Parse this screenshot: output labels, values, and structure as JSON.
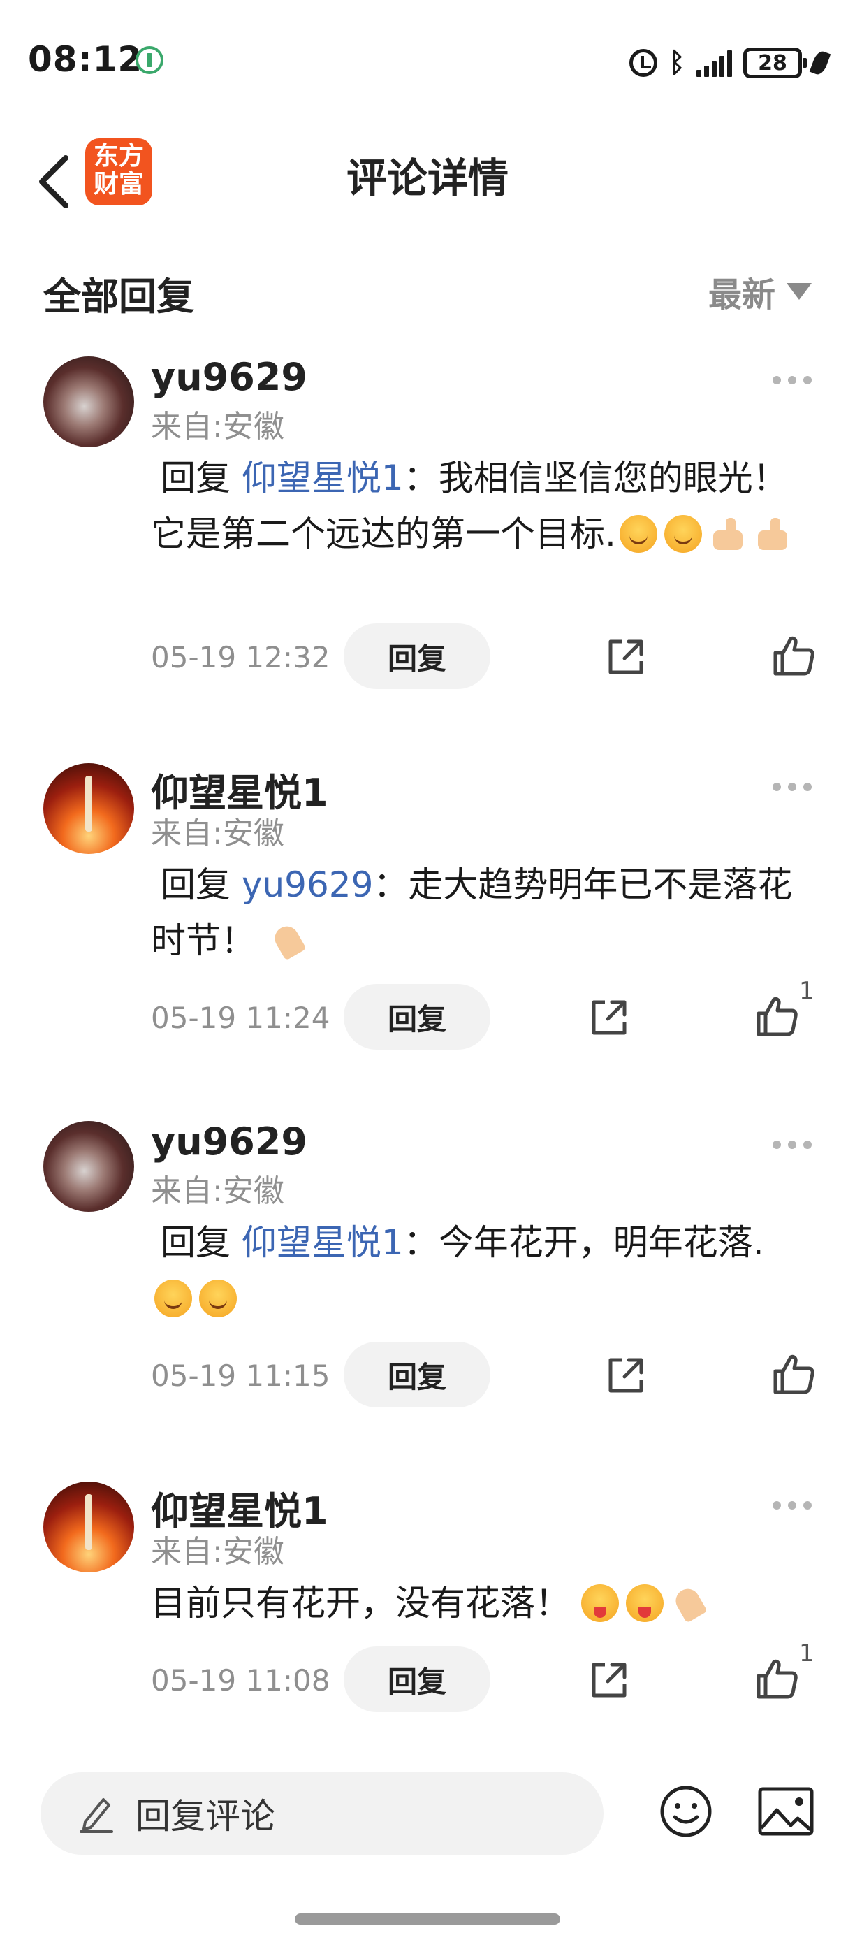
{
  "status_bar": {
    "time": "08:12",
    "battery": "28"
  },
  "header": {
    "title": "评论详情",
    "logo_line1": "东方",
    "logo_line2": "财富"
  },
  "section": {
    "title": "全部回复",
    "sort_label": "最新"
  },
  "comments": [
    {
      "username": "yu9629",
      "location": "来自:安徽",
      "reply_prefix": "回复",
      "reply_to": "仰望星悦1",
      "text": "：我相信坚信您的眼光！它是第二个远达的第一个目标.",
      "timestamp": "05-19 12:32",
      "reply_label": "回复",
      "likes": ""
    },
    {
      "username": "仰望星悦1",
      "location": "来自:安徽",
      "reply_prefix": "回复",
      "reply_to": "yu9629",
      "text": "：走大趋势明年已不是落花时节！",
      "timestamp": "05-19 11:24",
      "reply_label": "回复",
      "likes": "1"
    },
    {
      "username": "yu9629",
      "location": "来自:安徽",
      "reply_prefix": "回复",
      "reply_to": "仰望星悦1",
      "text": "：今年花开，明年花落.",
      "timestamp": "05-19 11:15",
      "reply_label": "回复",
      "likes": ""
    },
    {
      "username": "仰望星悦1",
      "location": "来自:安徽",
      "text": "目前只有花开，没有花落！",
      "timestamp": "05-19 11:08",
      "reply_label": "回复",
      "likes": "1"
    }
  ],
  "bottom_bar": {
    "reply_placeholder": "回复评论"
  },
  "icons": {
    "back": "back-arrow-icon",
    "more": "more-dots-icon",
    "share": "share-icon",
    "like": "thumbs-up-icon",
    "pencil": "pencil-icon",
    "emoji": "smiley-icon",
    "image": "image-icon"
  },
  "colors": {
    "brand": "#f2541f",
    "mention": "#3c66b3",
    "secondary_text": "#8f8f8f",
    "pill_bg": "#f2f2f2"
  }
}
